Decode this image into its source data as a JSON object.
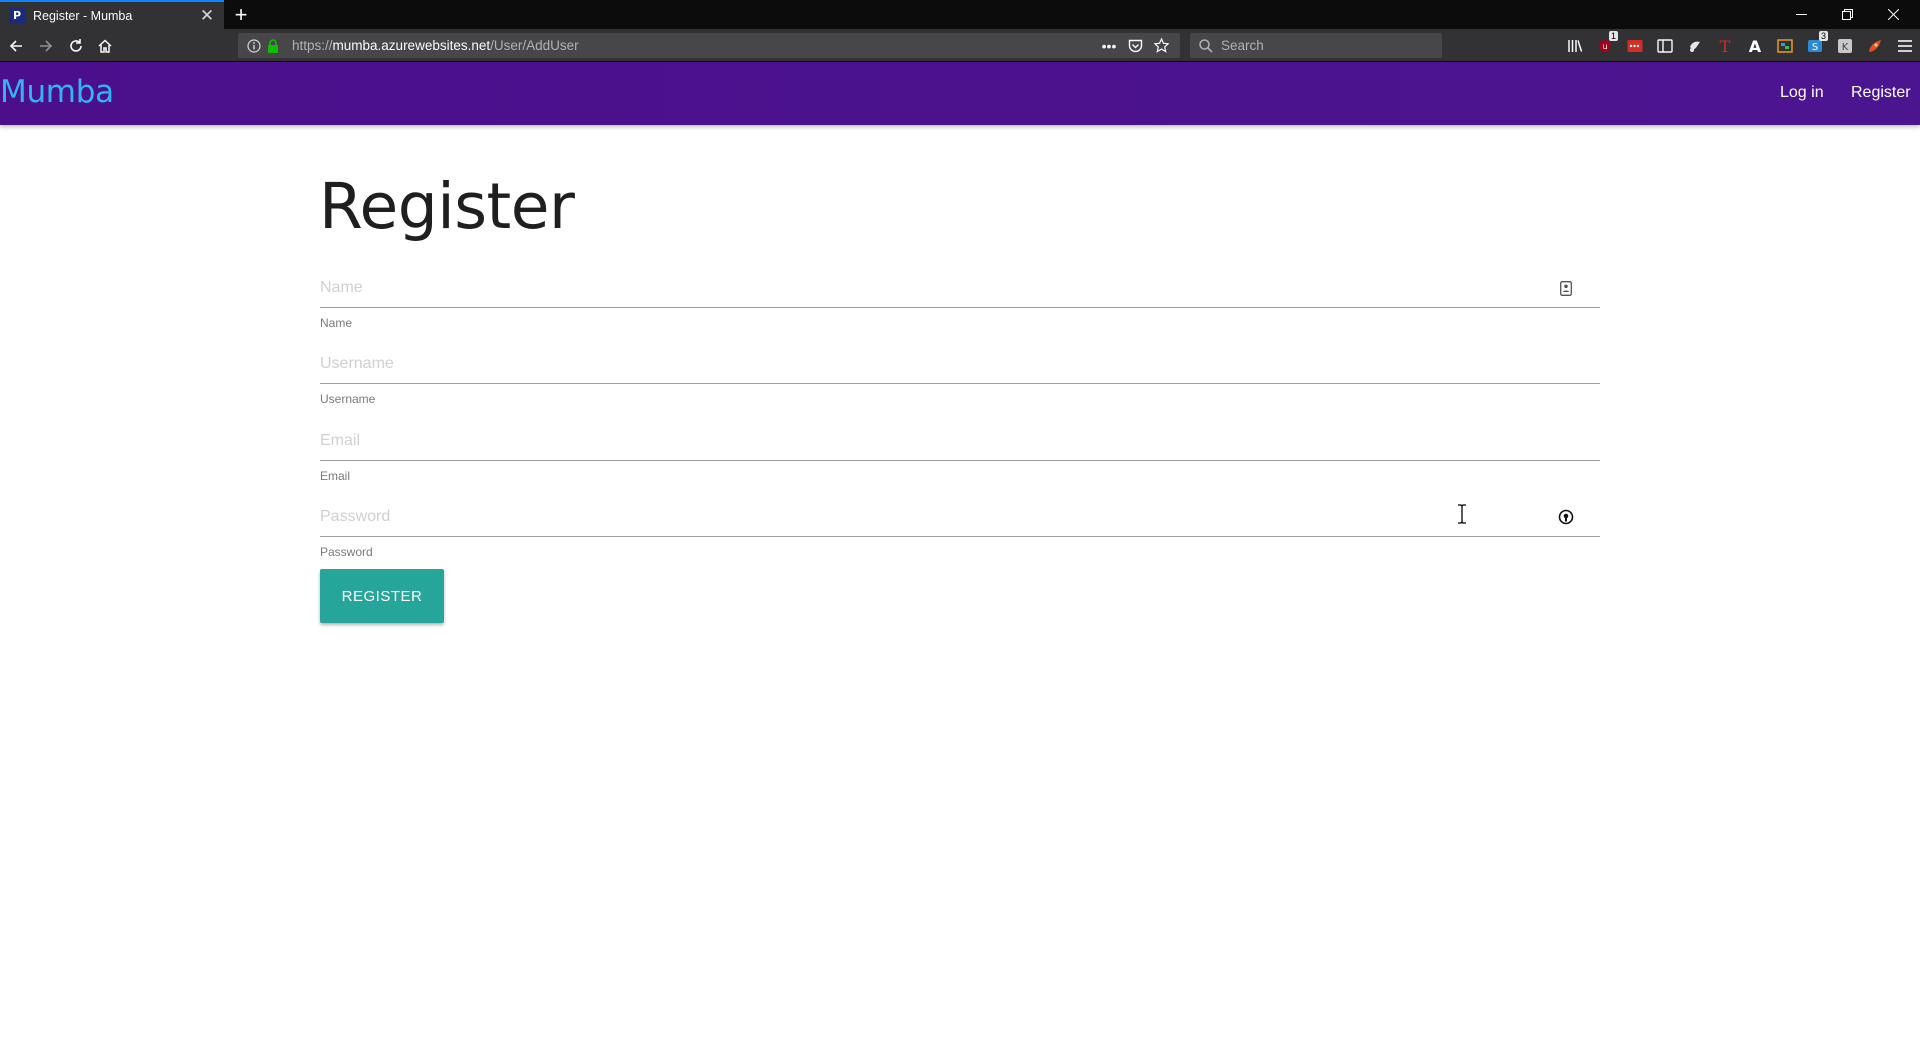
{
  "browser": {
    "tab_title": "Register - Mumba",
    "tab_favicon_letter": "P",
    "url_prefix": "https://",
    "url_host": "mumba.azurewebsites.net",
    "url_path": "/User/AddUser",
    "search_placeholder": "Search",
    "toolbar_badges": {
      "ublock": "1",
      "extension_s": "3"
    }
  },
  "site": {
    "brand": "Mumba",
    "nav": {
      "login": "Log in",
      "register": "Register"
    },
    "brand_color": "#33b3f5",
    "header_color": "#4b0f8c"
  },
  "form": {
    "title": "Register",
    "fields": {
      "name": {
        "placeholder": "Name",
        "label": "Name"
      },
      "username": {
        "placeholder": "Username",
        "label": "Username"
      },
      "email": {
        "placeholder": "Email",
        "label": "Email"
      },
      "password": {
        "placeholder": "Password",
        "label": "Password"
      }
    },
    "submit_label": "REGISTER",
    "accent_color": "#26a69a"
  }
}
